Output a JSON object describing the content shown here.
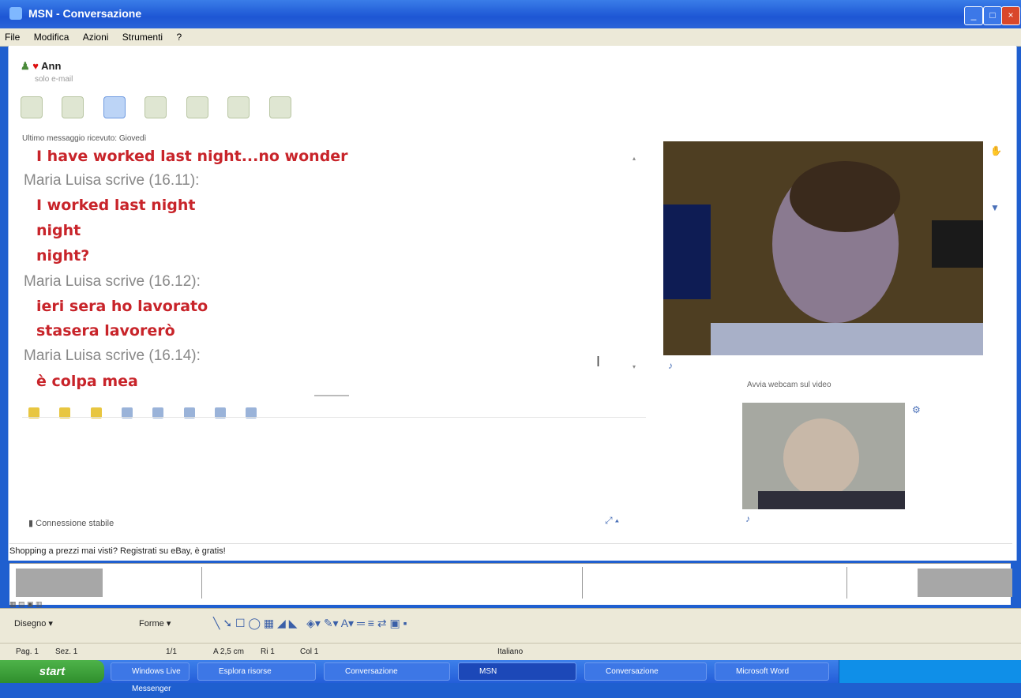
{
  "window": {
    "title": "MSN - Conversazione"
  },
  "menu": [
    "File",
    "Modifica",
    "Azioni",
    "Strumenti",
    "?"
  ],
  "contact": {
    "name": "Ann",
    "status": "solo e-mail"
  },
  "chat": {
    "header": "Ultimo messaggio ricevuto: Giovedì",
    "lines": [
      {
        "type": "msg",
        "text": "I have worked last night...no wonder"
      },
      {
        "type": "who",
        "text": "Maria Luisa scrive (16.11):"
      },
      {
        "type": "msg",
        "text": "I worked last night"
      },
      {
        "type": "msg",
        "text": "night"
      },
      {
        "type": "msg",
        "text": "night?"
      },
      {
        "type": "who",
        "text": "Maria Luisa scrive (16.12):"
      },
      {
        "type": "msg",
        "text": "ieri sera ho lavorato"
      },
      {
        "type": "msg",
        "text": "stasera lavorerò"
      },
      {
        "type": "who",
        "text": "Maria Luisa scrive (16.14):"
      },
      {
        "type": "msg",
        "text": "è colpa mea"
      }
    ]
  },
  "connection": {
    "label": "Connessione stabile"
  },
  "video": {
    "small_label": "Avvia webcam sul video"
  },
  "ad": {
    "text": "Shopping a prezzi mai visti? Registrati su eBay, è gratis!"
  },
  "word": {
    "draw_label": "Disegno ▾",
    "autoforme_label": "Forme ▾"
  },
  "word_status": {
    "pag": "Pag. 1",
    "sez": "Sez. 1",
    "page_of": "1/1",
    "pos": "A 2,5 cm",
    "riga": "Ri 1",
    "col": "Col 1",
    "lang": "Italiano"
  },
  "taskbar": {
    "start": "start",
    "tasks": [
      "Windows Live Messenger",
      "Esplora risorse",
      "Conversazione",
      "MSN",
      "Conversazione",
      "Microsoft Word"
    ]
  }
}
